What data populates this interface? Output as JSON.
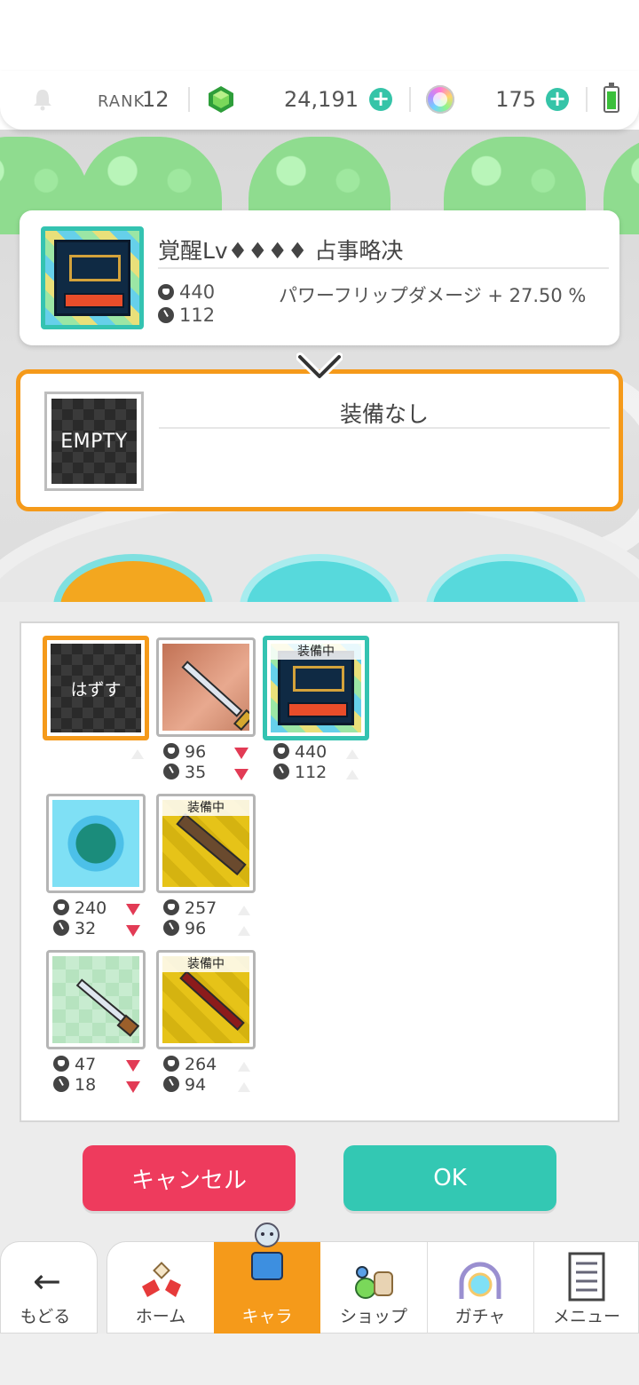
{
  "status_bar": {
    "rank_label": "RANK",
    "rank_value": "12",
    "gems": "24,191",
    "orbs": "175",
    "icons": [
      "bell-icon",
      "gem-icon",
      "plus-icon",
      "rainbow-orb-icon",
      "plus-icon",
      "battery-icon"
    ]
  },
  "current_item": {
    "title": "覚醒Lv♦♦♦♦ 占事略决",
    "power": "440",
    "cooldown": "112",
    "effect": "パワーフリップダメージ + 27.50 %",
    "icon": "book-icon"
  },
  "new_item": {
    "thumb_label": "EMPTY",
    "title": "装備なし"
  },
  "inventory": {
    "unequip_label": "はずす",
    "equipped_tag": "装備中",
    "items": [
      {
        "power": "96",
        "cooldown": "35",
        "icon": "sword-icon",
        "power_down": true,
        "cd_down": true
      },
      {
        "power": "440",
        "cooldown": "112",
        "icon": "book-icon",
        "equipped": true,
        "selected": true
      },
      {
        "power": "240",
        "cooldown": "32",
        "icon": "gem-orb-icon",
        "power_down": true,
        "cd_down": true
      },
      {
        "power": "257",
        "cooldown": "96",
        "icon": "dark-blade-icon",
        "equipped": true
      },
      {
        "power": "47",
        "cooldown": "18",
        "icon": "dagger-icon",
        "power_down": true,
        "cd_down": true
      },
      {
        "power": "264",
        "cooldown": "94",
        "icon": "red-blade-icon",
        "equipped": true
      }
    ]
  },
  "buttons": {
    "cancel": "キャンセル",
    "ok": "OK"
  },
  "nav": {
    "back": "もどる",
    "home": "ホーム",
    "chara": "キャラ",
    "shop": "ショップ",
    "gacha": "ガチャ",
    "menu": "メニュー",
    "active": "chara"
  },
  "colors": {
    "accent_orange": "#f59a1a",
    "accent_teal": "#34c3b1",
    "cancel_red": "#ee3b5d",
    "down_arrow": "#e23b55"
  }
}
